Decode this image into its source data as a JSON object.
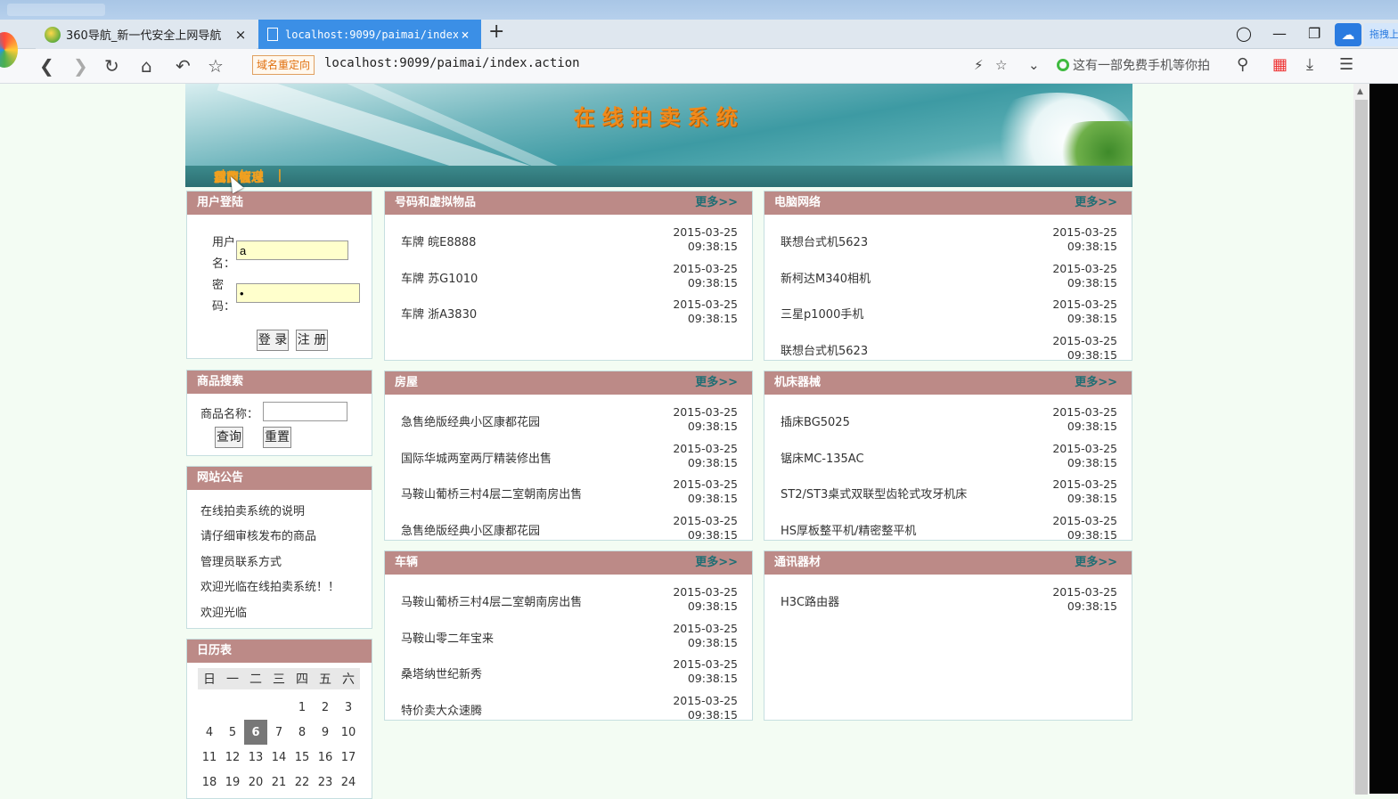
{
  "browser": {
    "tabs": [
      {
        "label": "360导航_新一代安全上网导航",
        "close": "×"
      },
      {
        "label": "localhost:9099/paimai/index.",
        "close": "×"
      }
    ],
    "new_tab": "+",
    "redirect_badge": "域名重定向",
    "url": "localhost:9099/paimai/index.action",
    "search_placeholder": "这有一部免费手机等你拍",
    "cloud_label": "拖拽上"
  },
  "site": {
    "title": "在线拍卖系统",
    "nav": [
      "首页",
      "留言板",
      "我的信息",
      "后台管理"
    ],
    "nav_sep": "|"
  },
  "login": {
    "header": "用户登陆",
    "user_label_1": "用户",
    "user_label_2": "名：",
    "username": "a",
    "pwd_label_1": "密",
    "pwd_label_2": "码：",
    "password": "•",
    "login_btn": "登 录",
    "register_btn": "注 册"
  },
  "search": {
    "header": "商品搜索",
    "label": "商品名称：",
    "query_btn": "查询",
    "reset_btn": "重置"
  },
  "notice": {
    "header": "网站公告",
    "items": [
      "在线拍卖系统的说明",
      "请仔细审核发布的商品",
      "管理员联系方式",
      "欢迎光临在线拍卖系统！！",
      "欢迎光临"
    ]
  },
  "calendar": {
    "header": "日历表",
    "weekdays": [
      "日",
      "一",
      "二",
      "三",
      "四",
      "五",
      "六"
    ],
    "weeks": [
      [
        "",
        "",
        "",
        "",
        "1",
        "2",
        "3"
      ],
      [
        "4",
        "5",
        "6",
        "7",
        "8",
        "9",
        "10"
      ],
      [
        "11",
        "12",
        "13",
        "14",
        "15",
        "16",
        "17"
      ],
      [
        "18",
        "19",
        "20",
        "21",
        "22",
        "23",
        "24"
      ]
    ],
    "today": "6"
  },
  "more": "更多>>",
  "categories": [
    {
      "title": "号码和虚拟物品",
      "items": [
        {
          "name": "车牌 皖E8888",
          "date": "2015-03-25",
          "time": "09:38:15"
        },
        {
          "name": "车牌 苏G1010",
          "date": "2015-03-25",
          "time": "09:38:15"
        },
        {
          "name": "车牌 浙A3830",
          "date": "2015-03-25",
          "time": "09:38:15"
        }
      ]
    },
    {
      "title": "电脑网络",
      "items": [
        {
          "name": "联想台式机5623",
          "date": "2015-03-25",
          "time": "09:38:15"
        },
        {
          "name": "新柯达M340相机",
          "date": "2015-03-25",
          "time": "09:38:15"
        },
        {
          "name": "三星p1000手机",
          "date": "2015-03-25",
          "time": "09:38:15"
        },
        {
          "name": "联想台式机5623",
          "date": "2015-03-25",
          "time": "09:38:15"
        }
      ]
    },
    {
      "title": "房屋",
      "items": [
        {
          "name": "急售绝版经典小区康都花园",
          "date": "2015-03-25",
          "time": "09:38:15"
        },
        {
          "name": "国际华城两室两厅精装修出售",
          "date": "2015-03-25",
          "time": "09:38:15"
        },
        {
          "name": "马鞍山葡桥三村4层二室朝南房出售",
          "date": "2015-03-25",
          "time": "09:38:15"
        },
        {
          "name": "急售绝版经典小区康都花园",
          "date": "2015-03-25",
          "time": "09:38:15"
        }
      ]
    },
    {
      "title": "机床器械",
      "items": [
        {
          "name": "插床BG5025",
          "date": "2015-03-25",
          "time": "09:38:15"
        },
        {
          "name": "锯床MC-135AC",
          "date": "2015-03-25",
          "time": "09:38:15"
        },
        {
          "name": "ST2/ST3桌式双联型齿轮式攻牙机床",
          "date": "2015-03-25",
          "time": "09:38:15"
        },
        {
          "name": "HS厚板整平机/精密整平机",
          "date": "2015-03-25",
          "time": "09:38:15"
        }
      ]
    },
    {
      "title": "车辆",
      "items": [
        {
          "name": "马鞍山葡桥三村4层二室朝南房出售",
          "date": "2015-03-25",
          "time": "09:38:15"
        },
        {
          "name": "马鞍山零二年宝来",
          "date": "2015-03-25",
          "time": "09:38:15"
        },
        {
          "name": "桑塔纳世纪新秀",
          "date": "2015-03-25",
          "time": "09:38:15"
        },
        {
          "name": "特价卖大众速腾",
          "date": "2015-03-25",
          "time": "09:38:15"
        }
      ]
    },
    {
      "title": "通讯器材",
      "items": [
        {
          "name": "H3C路由器",
          "date": "2015-03-25",
          "time": "09:38:15"
        }
      ]
    }
  ]
}
